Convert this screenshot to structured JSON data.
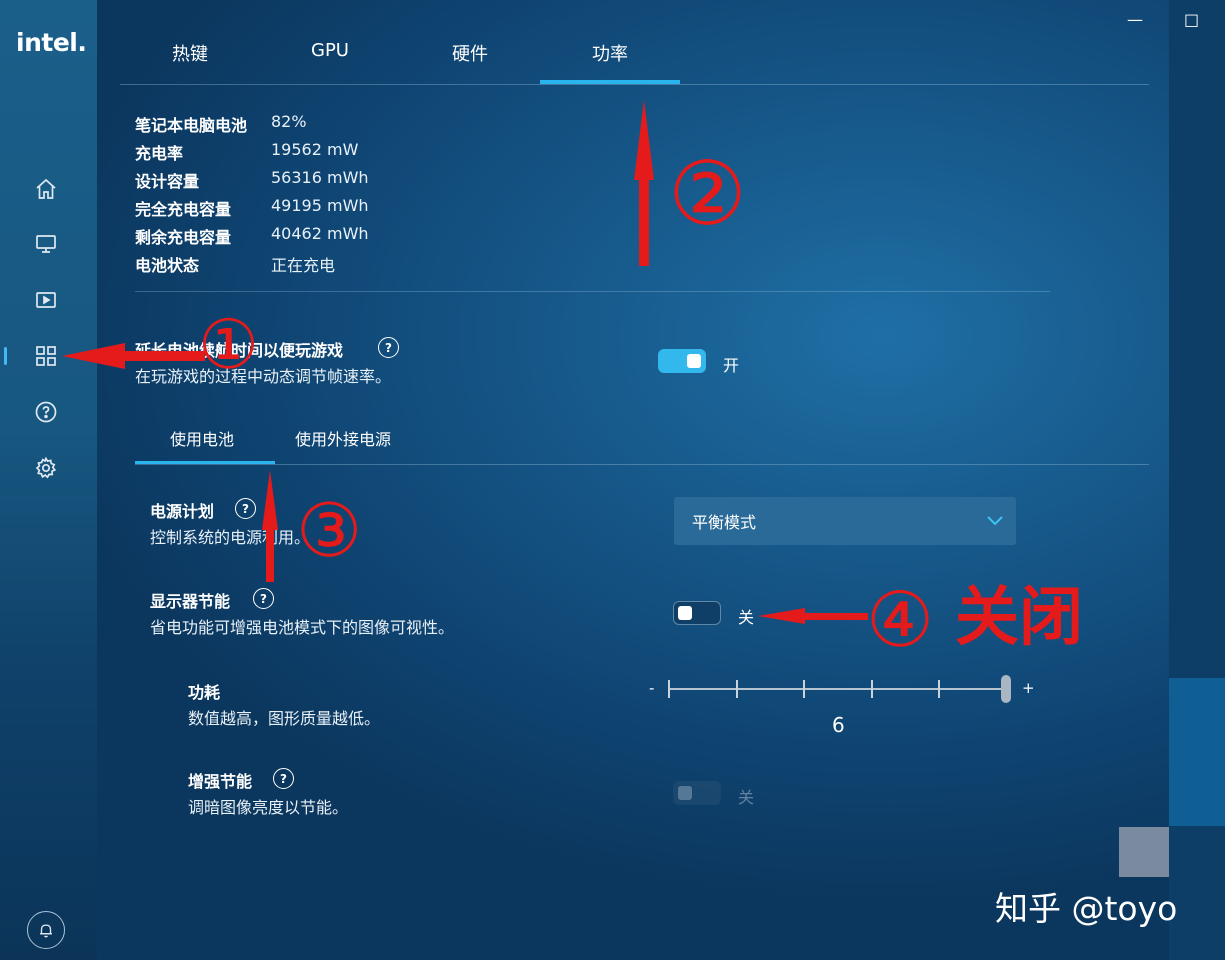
{
  "brand": "intel.",
  "window_controls": {
    "minimize": "—",
    "maximize": "□"
  },
  "tabs": [
    {
      "label": "热键"
    },
    {
      "label": "GPU"
    },
    {
      "label": "硬件"
    },
    {
      "label": "功率",
      "active": true
    }
  ],
  "battery_info": {
    "rows": [
      {
        "label": "笔记本电脑电池",
        "value": "82%"
      },
      {
        "label": "充电率",
        "value": "19562 mW"
      },
      {
        "label": "设计容量",
        "value": "56316 mWh"
      },
      {
        "label": "完全充电容量",
        "value": "49195 mWh"
      },
      {
        "label": "剩余充电容量",
        "value": "40462 mWh"
      },
      {
        "label": "电池状态",
        "value": "正在充电"
      }
    ]
  },
  "extend_gaming": {
    "title": "延长电池续航时间以便玩游戏",
    "desc": "在玩游戏的过程中动态调节帧速率。",
    "state_label": "开",
    "enabled": true
  },
  "power_tabs": [
    {
      "label": "使用电池",
      "active": true
    },
    {
      "label": "使用外接电源"
    }
  ],
  "power_plan": {
    "title": "电源计划",
    "desc": "控制系统的电源利用。",
    "selected": "平衡模式"
  },
  "display_saving": {
    "title": "显示器节能",
    "desc": "省电功能可增强电池模式下的图像可视性。",
    "state_label": "关",
    "enabled": false
  },
  "power_consumption": {
    "title": "功耗",
    "desc": "数值越高，图形质量越低。",
    "minus": "-",
    "plus": "+",
    "value": "6",
    "level": 6,
    "max": 6
  },
  "enhanced_saving": {
    "title": "增强节能",
    "desc": "调暗图像亮度以节能。",
    "state_label": "关",
    "enabled": false,
    "disabled": true
  },
  "annotations": {
    "n1": "①",
    "n2": "②",
    "n3": "③",
    "n4": "④",
    "n4_text": "关闭",
    "color": "#e51a1a"
  },
  "watermark": "知乎 @toyo",
  "colors": {
    "accent": "#2ab4ee",
    "toggle_on": "#33b8ee"
  },
  "help_glyph": "?",
  "icons": [
    "home-icon",
    "display-icon",
    "video-icon",
    "apps-grid-icon",
    "help-circle-icon",
    "gear-icon",
    "bell-icon",
    "chevron-down-icon"
  ]
}
